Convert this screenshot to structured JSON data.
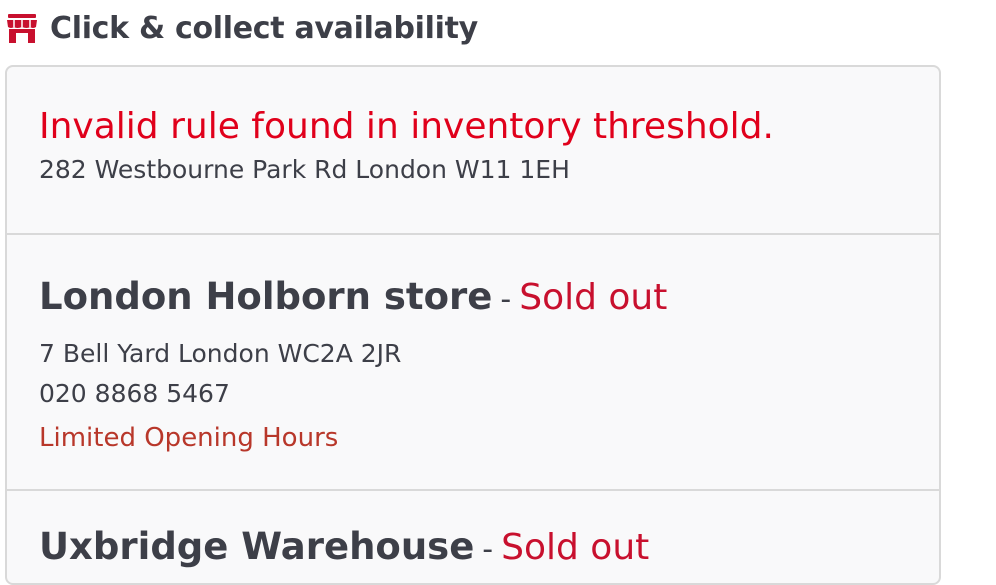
{
  "header": {
    "icon": "store-icon",
    "title": "Click & collect availability"
  },
  "locations": [
    {
      "error": "Invalid rule found in inventory threshold.",
      "address": "282 Westbourne Park Rd London W11 1EH"
    },
    {
      "name": "London Holborn store",
      "separator": "-",
      "status": "Sold out",
      "address": "7 Bell Yard London WC2A 2JR",
      "phone": "020 8868 5467",
      "hours_link": "Limited Opening Hours"
    },
    {
      "name": "Uxbridge Warehouse",
      "separator": "-",
      "status": "Sold out"
    }
  ],
  "colors": {
    "error": "#e0001b",
    "status": "#c8102e",
    "link": "#b8372a",
    "text": "#3d3f48",
    "icon": "#c8102e"
  }
}
